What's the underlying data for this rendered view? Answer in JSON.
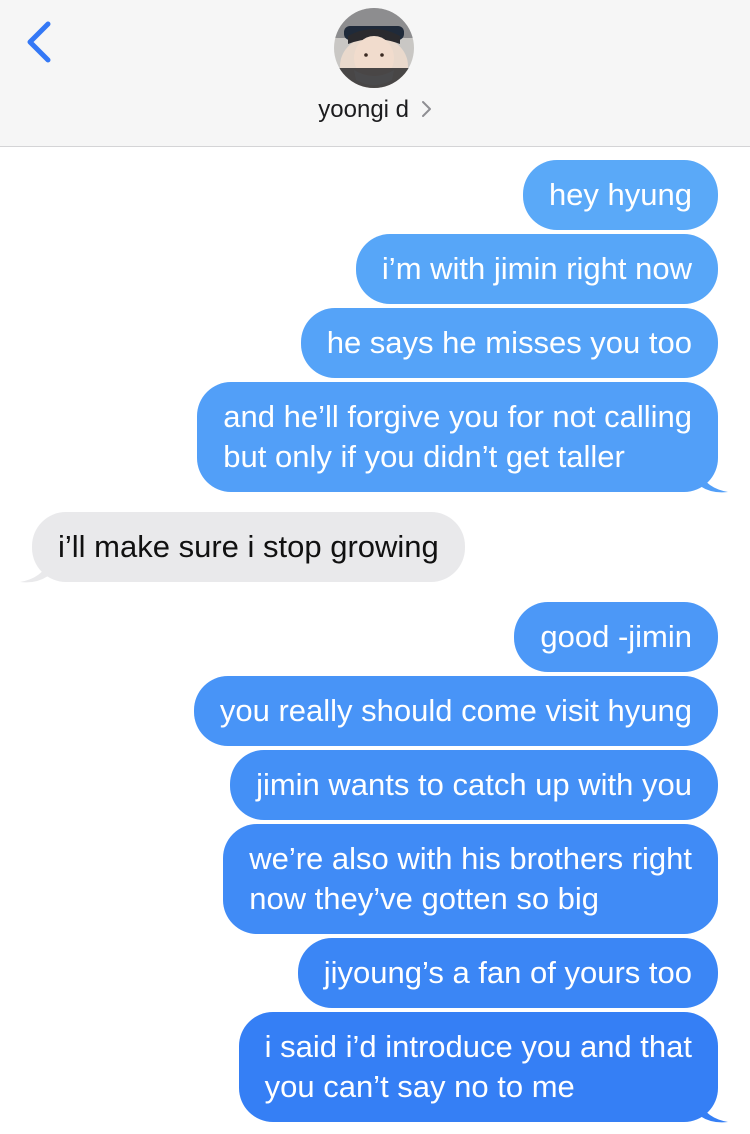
{
  "header": {
    "contact_name": "yoongi d",
    "back_icon": "chevron-left-icon",
    "details_icon": "chevron-right-icon",
    "accent_color": "#3478f6"
  },
  "colors": {
    "sent_top": "#5aaaf8",
    "sent_bottom": "#2f7cf4",
    "received": "#e9e9eb"
  },
  "messages": [
    {
      "from": "me",
      "lines": [
        "hey hyung"
      ]
    },
    {
      "from": "me",
      "lines": [
        "i’m with jimin right now"
      ]
    },
    {
      "from": "me",
      "lines": [
        "he says he misses you too"
      ]
    },
    {
      "from": "me",
      "lines": [
        "and he’ll forgive you for not calling",
        "but only if you didn’t get taller"
      ]
    },
    {
      "from": "them",
      "lines": [
        "i’ll make sure i stop growing"
      ]
    },
    {
      "from": "me",
      "lines": [
        "good -jimin"
      ]
    },
    {
      "from": "me",
      "lines": [
        "you really should come visit hyung"
      ]
    },
    {
      "from": "me",
      "lines": [
        "jimin wants to catch up with you"
      ]
    },
    {
      "from": "me",
      "lines": [
        "we’re also with his brothers right",
        "now they’ve gotten so big"
      ]
    },
    {
      "from": "me",
      "lines": [
        "jiyoung’s a fan of yours too"
      ]
    },
    {
      "from": "me",
      "lines": [
        "i said i’d introduce you and that",
        "you can’t say no to me"
      ]
    }
  ]
}
